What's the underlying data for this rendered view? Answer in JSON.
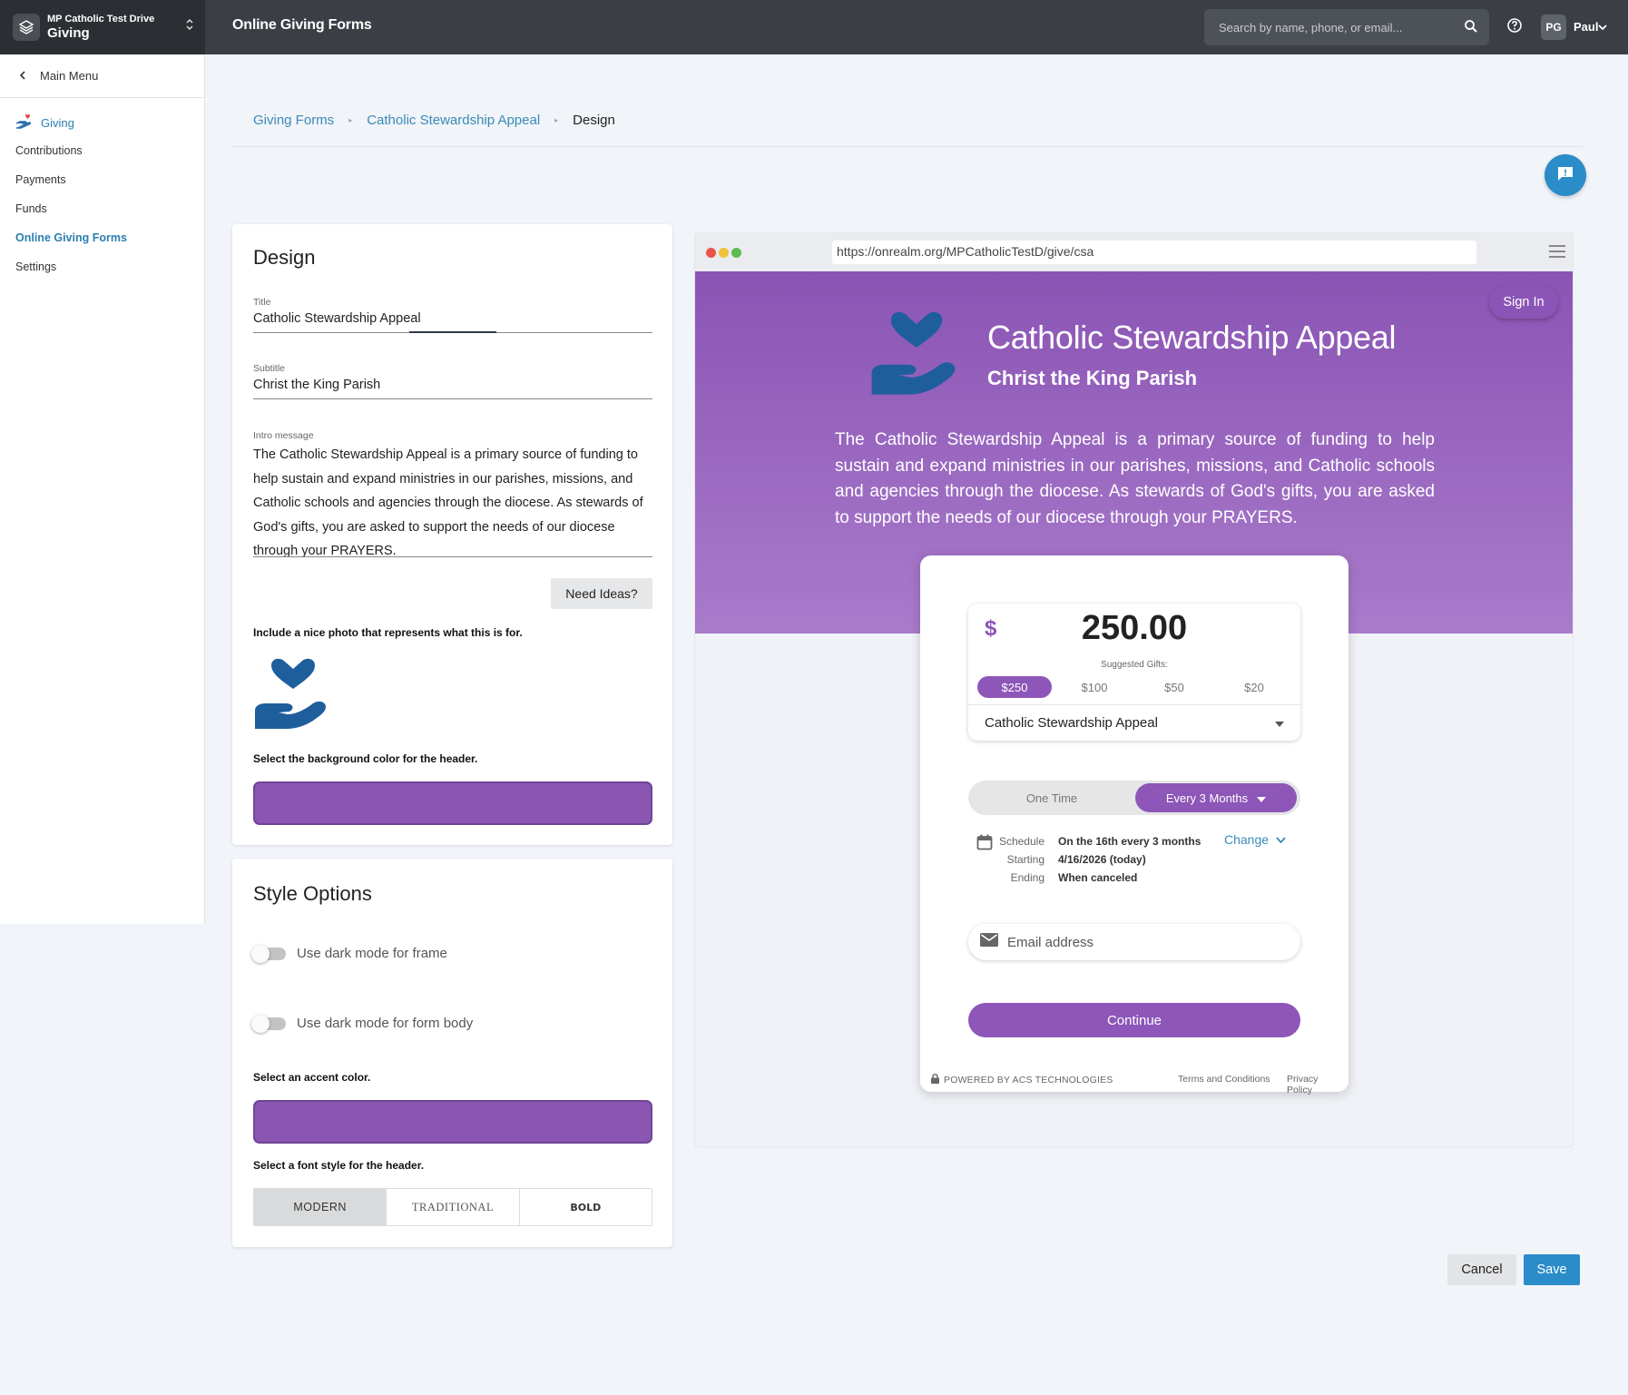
{
  "topbar": {
    "org_name": "MP Catholic Test Drive",
    "app_name": "Giving",
    "page_heading": "Online Giving Forms",
    "search_placeholder": "Search by name, phone, or email...",
    "user_initials": "PG",
    "user_name": "Paul"
  },
  "sidebar": {
    "back_label": "Main Menu",
    "section_label": "Giving",
    "items": [
      {
        "label": "Contributions"
      },
      {
        "label": "Payments"
      },
      {
        "label": "Funds"
      },
      {
        "label": "Online Giving Forms",
        "active": true
      },
      {
        "label": "Settings"
      }
    ]
  },
  "breadcrumb": {
    "items": [
      "Giving Forms",
      "Catholic Stewardship Appeal"
    ],
    "current": "Design"
  },
  "design": {
    "heading": "Design",
    "title_label": "Title",
    "title_value": "Catholic Stewardship Appeal",
    "subtitle_label": "Subtitle",
    "subtitle_value": "Christ the King Parish",
    "intro_label": "Intro message",
    "intro_value": "The Catholic Stewardship Appeal is a primary source of funding to help sustain and expand ministries in our parishes, missions, and Catholic schools and agencies through the diocese. As stewards of God's gifts, you are asked to support the needs of our diocese through your PRAYERS.",
    "need_ideas_label": "Need Ideas?",
    "photo_hint": "Include a nice photo that represents what this is for.",
    "bg_color_hint": "Select the background color for the header.",
    "header_bg_color": "#8a56b2"
  },
  "style_options": {
    "heading": "Style Options",
    "dark_frame_label": "Use dark mode for frame",
    "dark_frame_on": false,
    "dark_body_label": "Use dark mode for form body",
    "dark_body_on": false,
    "accent_hint": "Select an accent color.",
    "accent_color": "#8a56b2",
    "font_hint": "Select a font style for the header.",
    "font_options": [
      "MODERN",
      "TRADITIONAL",
      "BOLD"
    ],
    "font_selected": "MODERN"
  },
  "preview": {
    "url": "https://onrealm.org/MPCatholicTestD/give/csa",
    "sign_in_label": "Sign In",
    "title": "Catholic Stewardship Appeal",
    "subtitle": "Christ the King Parish",
    "intro": "The Catholic Stewardship Appeal is a primary source of funding to help sustain and expand ministries in our parishes, missions, and Catholic schools and agencies through the diocese. As stewards of God's gifts, you are asked to support the needs of our diocese through your PRAYERS.",
    "currency": "$",
    "amount": "250.00",
    "suggested_label": "Suggested Gifts:",
    "gifts": [
      "$250",
      "$100",
      "$50",
      "$20"
    ],
    "gift_selected": "$250",
    "fund": "Catholic Stewardship Appeal",
    "freq_one_time": "One Time",
    "freq_recurring": "Every 3 Months",
    "schedule_label": "Schedule",
    "schedule_value": "On the 16th every 3 months",
    "starting_label": "Starting",
    "starting_value": "4/16/2026 (today)",
    "ending_label": "Ending",
    "ending_value": "When canceled",
    "change_label": "Change",
    "email_placeholder": "Email address",
    "continue_label": "Continue",
    "powered_by": "POWERED BY ACS TECHNOLOGIES",
    "terms_label": "Terms and Conditions",
    "privacy_label": "Privacy Policy"
  },
  "actions": {
    "cancel_label": "Cancel",
    "save_label": "Save"
  },
  "colors": {
    "topbar": "#3b3f45",
    "accent_blue": "#2a8cc8",
    "brand_purple": "#8d56b8",
    "link": "#3a8ab8"
  }
}
